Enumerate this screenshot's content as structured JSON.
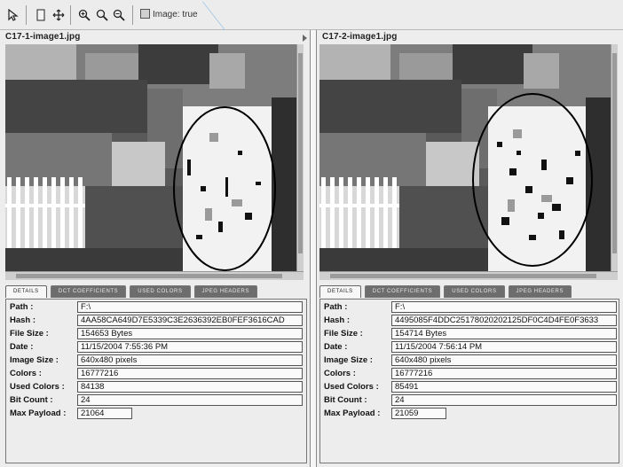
{
  "toolbar": {
    "image_label": "Image: true",
    "buttons": [
      "select-tool",
      "page-tool",
      "move-tool",
      "zoom-in",
      "zoom-reset",
      "zoom-out"
    ]
  },
  "colors": {
    "panel_bg": "#ededed",
    "tab_inactive": "#6d6d6d",
    "tab_active": "#f7f7f7",
    "field_bg": "#fafafa"
  },
  "tabs": [
    "DETAILS",
    "DCT COEFFICIENTS",
    "USED COLORS",
    "JPEG HEADERS"
  ],
  "labels": {
    "path": "Path :",
    "hash": "Hash :",
    "file_size": "File Size :",
    "date": "Date :",
    "image_size": "Image Size :",
    "colors": "Colors :",
    "used_colors": "Used Colors :",
    "bit_count": "Bit Count :",
    "max_payload": "Max Payload :"
  },
  "left": {
    "title": "C17-1-image1.jpg",
    "path": "F:\\",
    "hash": "4AA58CA649D7E5339C3E2636392EB0FEF3616CAD",
    "file_size": "154653 Bytes",
    "date": "11/15/2004 7:55:36 PM",
    "image_size": "640x480 pixels",
    "colors": "16777216",
    "used_colors": "84138",
    "bit_count": "24",
    "max_payload": "21064"
  },
  "right": {
    "title": "C17-2-image1.jpg",
    "path": "F:\\",
    "hash": "4495085F4DDC25178020202125DF0C4D4FE0F3633",
    "file_size": "154714 Bytes",
    "date": "11/15/2004 7:56:14 PM",
    "image_size": "640x480 pixels",
    "colors": "16777216",
    "used_colors": "85491",
    "bit_count": "24",
    "max_payload": "21059"
  }
}
